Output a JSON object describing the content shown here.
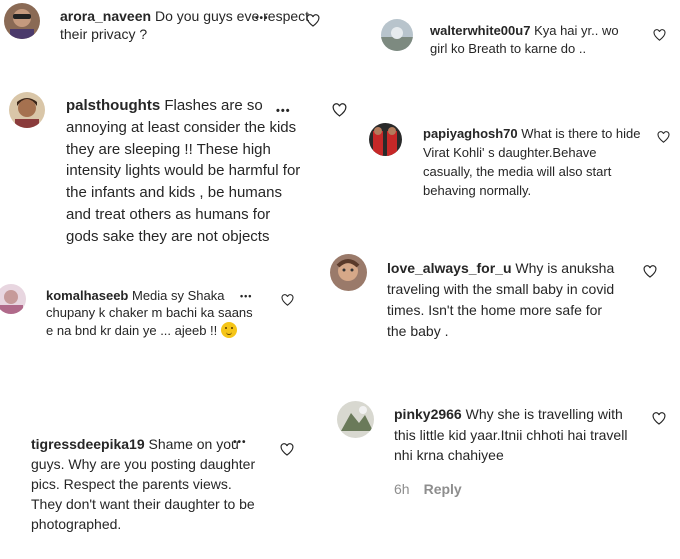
{
  "comments": [
    {
      "username": "arora_naveen",
      "text": "Do you guys eve respect their privacy ?"
    },
    {
      "username": "palsthoughts",
      "text": "Flashes are so annoying at least consider the kids they are sleeping !! These high intensity lights would be harmful for the infants and kids , be humans and treat others as humans for gods sake they are not objects"
    },
    {
      "username": "komalhaseeb",
      "text": "Media sy Shaka chupany k chaker m bachi ka saans e na bnd kr dain ye ... ajeeb !!"
    },
    {
      "username": "tigressdeepika19",
      "text": "Shame on you guys. Why are you posting daughter pics. Respect the parents views. They don't want their daughter to be photographed."
    },
    {
      "username": "walterwhite00u7",
      "text": "Kya hai yr.. wo girl ko Breath to karne do .."
    },
    {
      "username": "papiyaghosh70",
      "text": "What is there to hide Virat Kohli' s daughter.Behave casually, the media will also start behaving normally."
    },
    {
      "username": "love_always_for_u",
      "text": "Why is anuksha traveling with the small baby in covid times. Isn't the home more safe for the baby ."
    },
    {
      "username": "pinky2966",
      "text": "Why she is travelling with this little kid yaar.Itnii chhoti hai travell nhi krna chahiyee"
    }
  ],
  "last_comment_meta": {
    "time": "6h",
    "reply_label": "Reply"
  },
  "more_options_label": "•••",
  "icons": {
    "like": "heart-outline-icon",
    "more": "more-options-icon",
    "emoji": "smiling-face-emoji"
  },
  "colors": {
    "text": "#262626",
    "muted": "#8e8e8e",
    "background": "#ffffff"
  }
}
